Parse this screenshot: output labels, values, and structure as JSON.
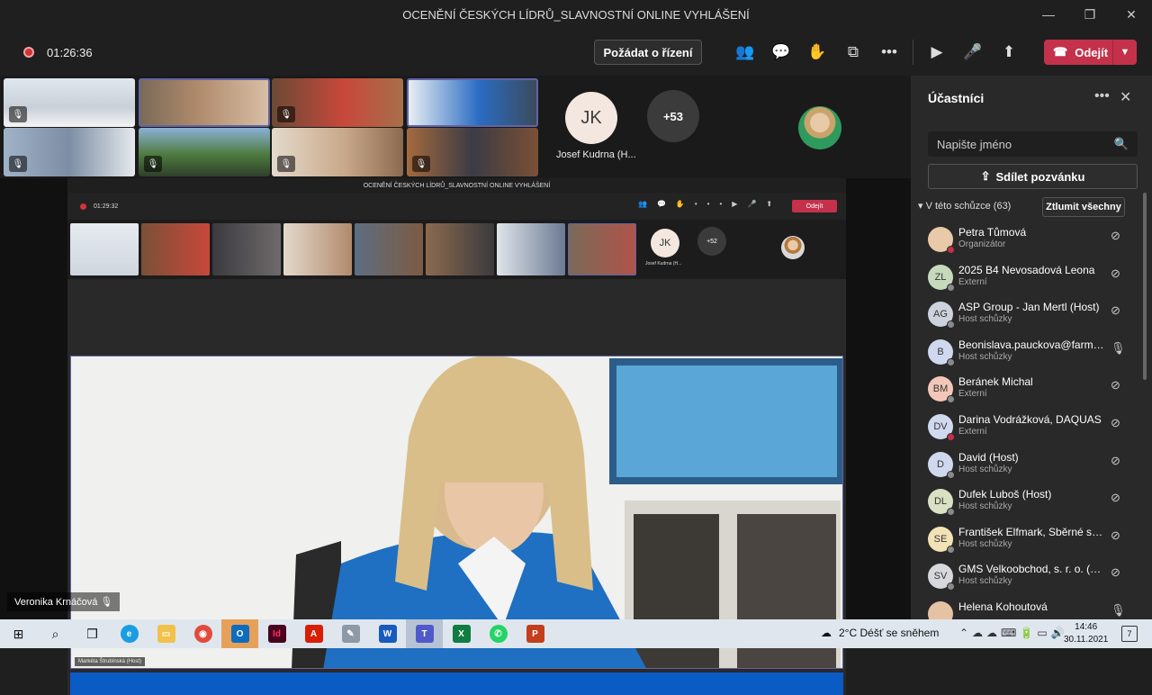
{
  "window": {
    "title": "OCENĚNÍ ČESKÝCH LÍDRŮ_SLAVNOSTNÍ ONLINE VYHLÁŠENÍ"
  },
  "toolbar": {
    "timer": "01:26:36",
    "request_control": "Požádat o řízení",
    "leave": "Odejít"
  },
  "stage": {
    "jk_initials": "JK",
    "jk_name": "Josef Kudrna (H...",
    "overflow_count": "+53",
    "local_user": "Veronika Krnáčová"
  },
  "shared_screen": {
    "title": "OCENĚNÍ ČESKÝCH LÍDRŮ_SLAVNOSTNÍ ONLINE VYHLÁŠENÍ",
    "timer": "01:29:32",
    "leave": "Odejít",
    "jk_initials": "JK",
    "jk_name": "Josef Kudrna (H...",
    "overflow_count": "+52",
    "video_label": "Markéta Štrubínská (Host)"
  },
  "panel": {
    "title": "Účastníci",
    "search_placeholder": "Napište jméno",
    "invite": "Sdílet pozvánku",
    "section": "V této schůzce (63)",
    "mute_all": "Ztlumit všechny",
    "participants": [
      {
        "initials": "",
        "name": "Petra Tůmová",
        "role": "Organizátor",
        "color": "#e8c9a8"
      },
      {
        "initials": "ZL",
        "name": "2025 B4 Nevosadová Leona",
        "role": "Externí",
        "color": "#c7d9bb"
      },
      {
        "initials": "AG",
        "name": "ASP Group - Jan Mertl (Host)",
        "role": "Host schůzky",
        "color": "#cdd3dc"
      },
      {
        "initials": "B",
        "name": "Beonislava.pauckova@farmak...",
        "role": "Host schůzky",
        "color": "#cfd8ee"
      },
      {
        "initials": "BM",
        "name": "Beránek Michal",
        "role": "Externí",
        "color": "#f2c7b8"
      },
      {
        "initials": "DV",
        "name": "Darina Vodrážková, DAQUAS",
        "role": "Externí",
        "color": "#d1d9f0"
      },
      {
        "initials": "D",
        "name": "David (Host)",
        "role": "Host schůzky",
        "color": "#cfd8ee"
      },
      {
        "initials": "DL",
        "name": "Dufek Luboš (Host)",
        "role": "Host schůzky",
        "color": "#d8e2c3"
      },
      {
        "initials": "SE",
        "name": "František Elfmark, Sběrné sur...",
        "role": "Host schůzky",
        "color": "#f3e2b5"
      },
      {
        "initials": "SV",
        "name": "GMS Velkoobchod, s. r. o. (Ho...",
        "role": "Host schůzky",
        "color": "#d6d8de"
      },
      {
        "initials": "",
        "name": "Helena Kohoutová",
        "role": "",
        "color": "#e6c2a4"
      }
    ]
  },
  "taskbar": {
    "weather": "2°C  Déšť se sněhem",
    "time": "14:46",
    "date": "30.11.2021",
    "notifications": "7"
  }
}
